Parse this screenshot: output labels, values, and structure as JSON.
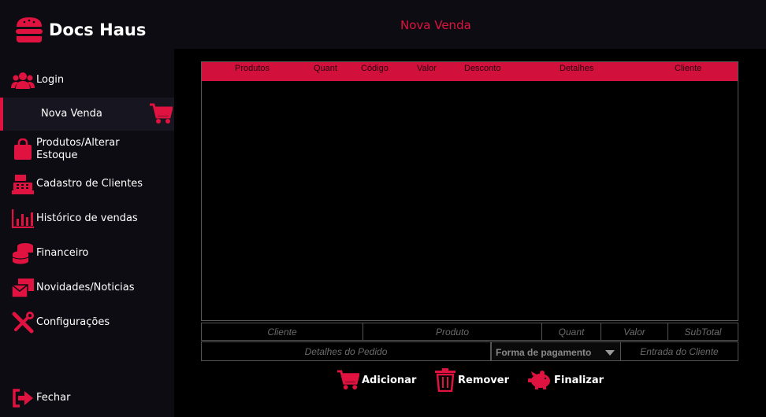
{
  "app": {
    "name": "Docs Haus",
    "page_title": "Nova Venda",
    "accent": "#e0123f"
  },
  "sidebar": {
    "items": [
      {
        "label": "Login",
        "icon": "users-icon"
      },
      {
        "label": "Nova Venda",
        "icon": "cart-icon",
        "active": true
      },
      {
        "label": "Produtos/Alterar\nEstoque",
        "icon": "shopping-bag-icon"
      },
      {
        "label": "Cadastro de Clientes",
        "icon": "cash-register-icon"
      },
      {
        "label": "Histórico de vendas",
        "icon": "bar-chart-icon"
      },
      {
        "label": "Financeiro",
        "icon": "coins-icon"
      },
      {
        "label": "Novidades/Noticias",
        "icon": "mail-icon"
      },
      {
        "label": "Configurações",
        "icon": "tools-icon"
      }
    ],
    "exit_label": "Fechar"
  },
  "table": {
    "columns": [
      "Produtos",
      "Quant",
      "Código",
      "Valor",
      "Desconto",
      "Detalhes",
      "Cliente"
    ],
    "rows": []
  },
  "form": {
    "cliente_placeholder": "Cliente",
    "produto_placeholder": "Produto",
    "quant_placeholder": "Quant",
    "valor_placeholder": "Valor",
    "subtotal_placeholder": "SubTotal",
    "detalhes_placeholder": "Detalhes do Pedido",
    "pagamento_label": "Forma de pagamento",
    "entrada_placeholder": "Entrada do Cliente"
  },
  "actions": {
    "add": "Adicionar",
    "remove": "Remover",
    "finish": "Finalizar"
  }
}
